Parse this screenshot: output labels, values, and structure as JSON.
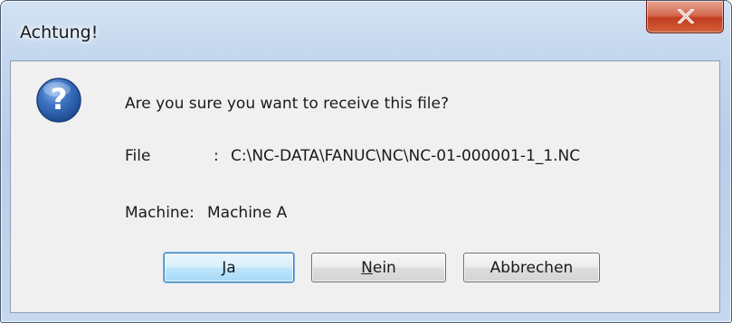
{
  "window": {
    "title": "Achtung!"
  },
  "message": {
    "question": "Are you sure you want to receive this file?",
    "file_label": "File",
    "file_separator": ":",
    "file_value": "C:\\NC-DATA\\FANUC\\NC\\NC-01-000001-1_1.NC",
    "machine_label": "Machine:",
    "machine_value": "Machine A"
  },
  "buttons": {
    "yes": "Ja",
    "no_mnemonic": "N",
    "no_rest": "ein",
    "cancel": "Abbrechen"
  },
  "icons": {
    "question": "question-icon",
    "close": "close-icon"
  },
  "colors": {
    "close_button": "#c23d1f",
    "question_icon": "#2c5fa8",
    "default_button_border": "#3c7fb1"
  }
}
